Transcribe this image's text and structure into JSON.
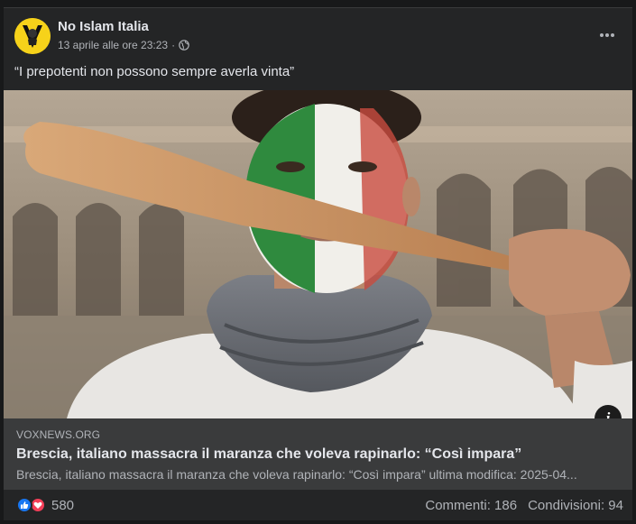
{
  "post": {
    "author": "No Islam Italia",
    "timestamp": "13 aprile alle ore 23:23",
    "separator": "·",
    "privacy_icon": "globe-icon",
    "more_icon": "more-horizontal-icon",
    "caption": "“I prepotenti non possono sempre averla vinta”"
  },
  "link_preview": {
    "domain": "VOXNEWS.ORG",
    "title": "Brescia, italiano massacra il maranza che voleva rapinarlo: “Così impara”",
    "description": "Brescia, italiano massacra il maranza che voleva rapinarlo: “Così impara” ultima modifica: 2025-04...",
    "info_icon": "i"
  },
  "footer": {
    "reaction_icons": [
      "like-icon",
      "love-icon"
    ],
    "reaction_count": "580",
    "comments": "Commenti: 186",
    "shares": "Condivisioni: 94"
  },
  "colors": {
    "background": "#242526",
    "link_box": "#3a3b3c",
    "text_primary": "#e4e6eb",
    "text_secondary": "#b0b3b8",
    "like_blue": "#1877f2",
    "love_red": "#f33e58",
    "avatar_yellow": "#f6d21a"
  }
}
